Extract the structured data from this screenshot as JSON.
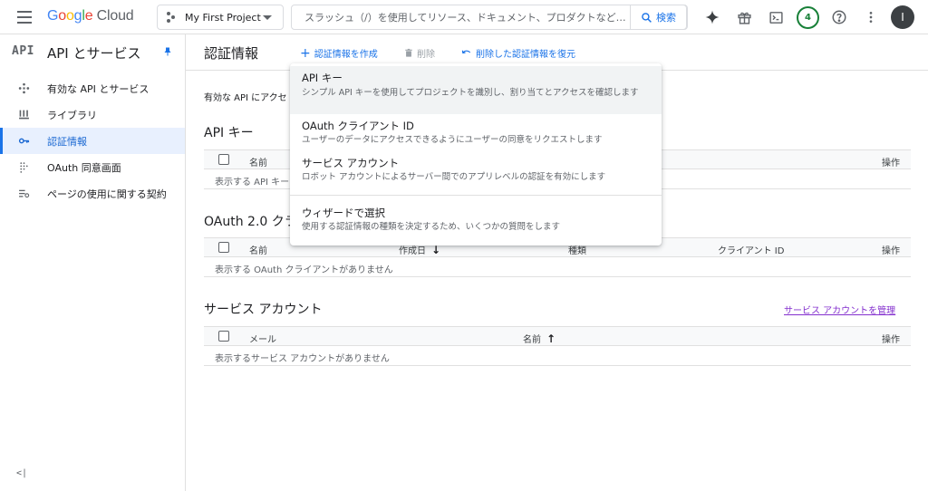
{
  "topbar": {
    "logo_google": "Google",
    "logo_cloud": "Cloud",
    "project_name": "My First Project",
    "search_placeholder": "スラッシュ（/）を使用してリソース、ドキュメント、プロダクトなど…",
    "search_button": "検索",
    "notifications_count": "4",
    "avatar_initial": "I",
    "icons": [
      "gemini-icon",
      "gift-icon",
      "cloud-shell-icon",
      "help-icon",
      "more-vert-icon"
    ]
  },
  "sidebar": {
    "logo": "API",
    "title": "API とサービス",
    "items": [
      {
        "label": "有効な API とサービス",
        "icon": "api-dots-icon",
        "active": false
      },
      {
        "label": "ライブラリ",
        "icon": "library-icon",
        "active": false
      },
      {
        "label": "認証情報",
        "icon": "key-icon",
        "active": true
      },
      {
        "label": "OAuth 同意画面",
        "icon": "oauth-dots-icon",
        "active": false
      },
      {
        "label": "ページの使用に関する契約",
        "icon": "settings-list-icon",
        "active": false
      }
    ],
    "collapse_label": "<|"
  },
  "main": {
    "title": "認証情報",
    "toolbar": {
      "create": "認証情報を作成",
      "delete": "削除",
      "restore": "削除した認証情報を復元"
    },
    "intro": "有効な API にアクセ",
    "api_keys": {
      "title": "API キー",
      "columns": [
        "名前",
        "操作"
      ],
      "empty": "表示する API キー"
    },
    "oauth": {
      "title": "OAuth 2.0 クラ",
      "columns": [
        "名前",
        "作成日",
        "種類",
        "クライアント ID",
        "操作"
      ],
      "empty": "表示する OAuth クライアントがありません"
    },
    "service_accounts": {
      "title": "サービス アカウント",
      "manage_link": "サービス アカウントを管理",
      "columns": [
        "メール",
        "名前",
        "操作"
      ],
      "empty": "表示するサービス アカウントがありません"
    }
  },
  "menu": {
    "items": [
      {
        "title": "API キー",
        "desc": "シンプル API キーを使用してプロジェクトを識別し、割り当てとアクセスを確認します"
      },
      {
        "title": "OAuth クライアント ID",
        "desc": "ユーザーのデータにアクセスできるようにユーザーの同意をリクエストします"
      },
      {
        "title": "サービス アカウント",
        "desc": "ロボット アカウントによるサーバー間でのアプリレベルの認証を有効にします"
      },
      {
        "title": "ウィザードで選択",
        "desc": "使用する認証情報の種類を決定するため、いくつかの質問をします"
      }
    ]
  },
  "colors": {
    "accent": "#1a73e8",
    "active_bg": "#e8f0fe",
    "link_visited": "#8430ce",
    "badge_green": "#188038"
  }
}
